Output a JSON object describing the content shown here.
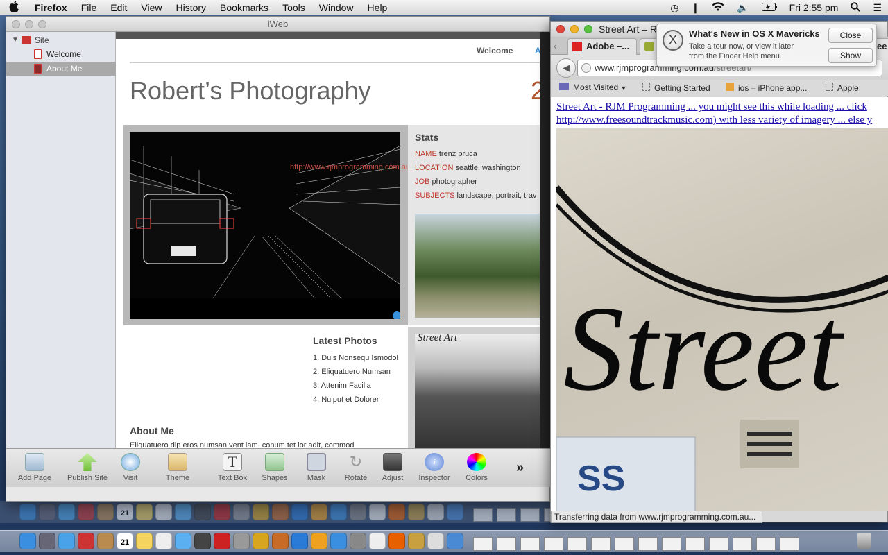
{
  "menubar": {
    "app": "Firefox",
    "items": [
      "File",
      "Edit",
      "View",
      "History",
      "Bookmarks",
      "Tools",
      "Window",
      "Help"
    ],
    "clock": "Fri 2:55 pm"
  },
  "iweb": {
    "title": "iWeb",
    "sidebar": {
      "root": "Site",
      "pages": [
        "Welcome",
        "About Me"
      ]
    },
    "page": {
      "nav_label": "Welcome",
      "nav_label_partial": "A",
      "site_title": "Robert’s Photography",
      "right_partial": "2",
      "image_overlay_text": "http://www.rjmprogramming.com.au/Business/SmallBusinessPages",
      "stats": {
        "heading": "Stats",
        "rows": [
          {
            "label": "NAME",
            "value": "trenz pruca"
          },
          {
            "label": "LOCATION",
            "value": "seattle, washington"
          },
          {
            "label": "JOB",
            "value": "photographer"
          },
          {
            "label": "SUBJECTS",
            "value": "landscape, portrait, trav"
          }
        ]
      },
      "latest": {
        "heading": "Latest Photos",
        "items": [
          "1. Duis Nonsequ Ismodol",
          "2. Eliquatuero Numsan",
          "3. Attenim Facilla",
          "4. Nulput et Dolorer"
        ]
      },
      "about": {
        "heading": "About Me",
        "body": "Eliquatuero dip eros numsan vent lam, conum tet lor adit, commod"
      },
      "street_art_caption": "Street Art"
    },
    "toolbar": [
      "Add Page",
      "Publish Site",
      "Visit",
      "Theme",
      "Text Box",
      "Shapes",
      "Mask",
      "Rotate",
      "Adjust",
      "Inspector",
      "Colors"
    ],
    "toolbar_more": "»"
  },
  "firefox": {
    "title": "Street Art – R",
    "tabs": [
      "Adobe –...",
      "",
      "ree"
    ],
    "url_host": "www.rjmprogramming.com.au",
    "url_path": "/streetart/",
    "bookmarks": [
      "Most Visited",
      "Getting Started",
      "ios – iPhone app...",
      "Apple"
    ],
    "links": [
      "Street Art - RJM Programming ... you might see this while loading ... click",
      "http://www.freesoundtrackmusic.com) with less variety of imagery ... else y"
    ],
    "hero_text": "Street",
    "sign_text": "SS",
    "status": "Transferring data from www.rjmprogramming.com.au..."
  },
  "notification": {
    "title": "What's New in OS X Mavericks",
    "body_line1": "Take a tour now, or view it later",
    "body_line2": "from the Finder Help menu.",
    "close": "Close",
    "show": "Show"
  },
  "dock": {
    "calendar_day": "21"
  },
  "colors": {
    "stats_label": "#c0392b",
    "link": "#1a0dab",
    "sidebar_selected": "#a9a9a9"
  }
}
